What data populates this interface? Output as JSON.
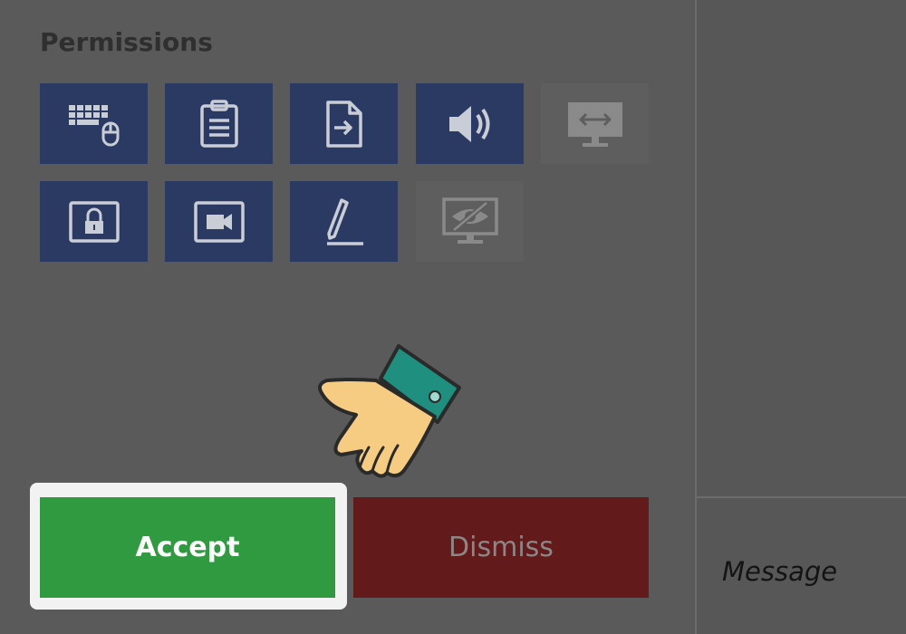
{
  "permissions": {
    "title": "Permissions",
    "tiles": [
      {
        "icon": "keyboard-mouse-icon",
        "enabled": true
      },
      {
        "icon": "clipboard-icon",
        "enabled": true
      },
      {
        "icon": "file-transfer-icon",
        "enabled": true
      },
      {
        "icon": "speaker-icon",
        "enabled": true
      },
      {
        "icon": "remote-screen-arrows-icon",
        "enabled": false
      },
      {
        "icon": "lock-screen-icon",
        "enabled": true
      },
      {
        "icon": "video-camera-icon",
        "enabled": true
      },
      {
        "icon": "pen-draw-icon",
        "enabled": true
      },
      {
        "icon": "hidden-screen-eye-icon",
        "enabled": false
      }
    ]
  },
  "buttons": {
    "accept_label": "Accept",
    "dismiss_label": "Dismiss"
  },
  "chat": {
    "message_placeholder": "Message"
  },
  "colors": {
    "tile_active": "#2b3a63",
    "tile_inactive": "#5e5e5e",
    "accept": "#2f9a40",
    "dismiss": "#631a1a"
  }
}
